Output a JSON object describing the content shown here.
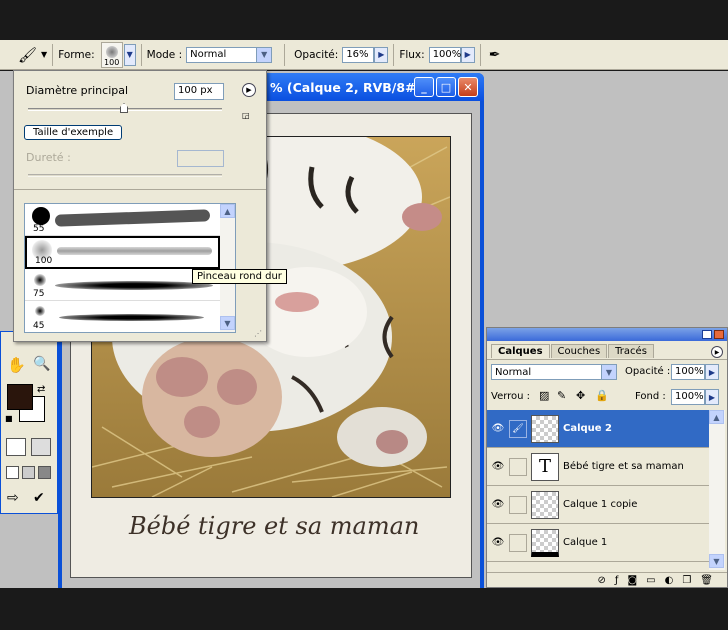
{
  "options_bar": {
    "forme_label": "Forme:",
    "brush_size": "100",
    "mode_label": "Mode :",
    "mode_value": "Normal",
    "opacite_label": "Opacité:",
    "opacite_value": "16%",
    "flux_label": "Flux:",
    "flux_value": "100%"
  },
  "document": {
    "title": "% (Calque 2, RVB/8#)",
    "caption": "Bébé tigre et sa maman"
  },
  "brush_panel": {
    "diametre_label": "Diamètre principal",
    "diametre_value": "100 px",
    "taille_button": "Taille d'exemple",
    "durete_label": "Dureté :",
    "brushes": [
      {
        "num": "55"
      },
      {
        "num": "100"
      },
      {
        "num": "75"
      },
      {
        "num": "45"
      }
    ],
    "tooltip": "Pinceau rond dur"
  },
  "layers_panel": {
    "tabs": [
      "Calques",
      "Couches",
      "Tracés"
    ],
    "blend_mode": "Normal",
    "opacite_label": "Opacité :",
    "opacite_value": "100%",
    "verrou_label": "Verrou :",
    "fond_label": "Fond :",
    "fond_value": "100%",
    "layers": [
      {
        "name": "Calque 2"
      },
      {
        "name": "Bébé tigre et sa maman"
      },
      {
        "name": "Calque 1 copie"
      },
      {
        "name": "Calque 1"
      }
    ]
  },
  "colors": {
    "accent": "#316ac5",
    "titlebar": "#0a50d8",
    "foreground_swatch": "#2a150c",
    "background_swatch": "#ffffff"
  },
  "icons": {
    "brush_tool": "brush-icon",
    "airbrush": "airbrush-icon",
    "hand": "hand-icon",
    "zoom": "zoom-icon",
    "eye": "eye-icon"
  }
}
